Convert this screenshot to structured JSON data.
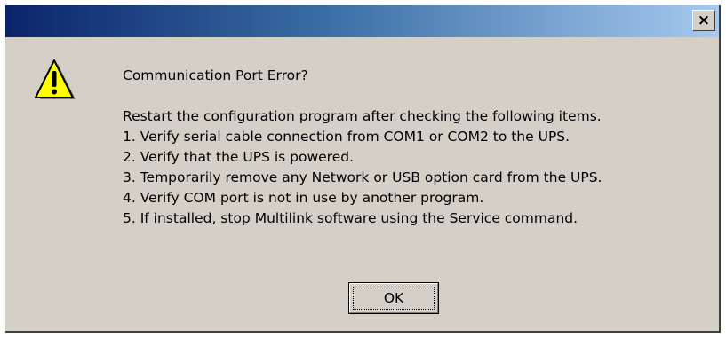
{
  "window": {
    "title": ""
  },
  "titlebar": {
    "close_glyph": "×"
  },
  "icon": {
    "name": "warning-icon",
    "color": "#ffff00"
  },
  "message": {
    "heading": "Communication Port Error?",
    "lines": [
      "Restart the configuration program after checking the following items.",
      "1. Verify serial cable connection from COM1 or COM2 to the UPS.",
      "2. Verify that the UPS is powered.",
      "3. Temporarily remove any Network or USB option card from the UPS.",
      "4. Verify COM port is not in use by another program.",
      "5. If installed, stop Multilink software using the Service command."
    ]
  },
  "buttons": {
    "ok_label": "OK"
  },
  "colors": {
    "dialog_bg": "#d4d0c8",
    "titlebar_start": "#0a246a",
    "titlebar_end": "#a6caf0"
  }
}
